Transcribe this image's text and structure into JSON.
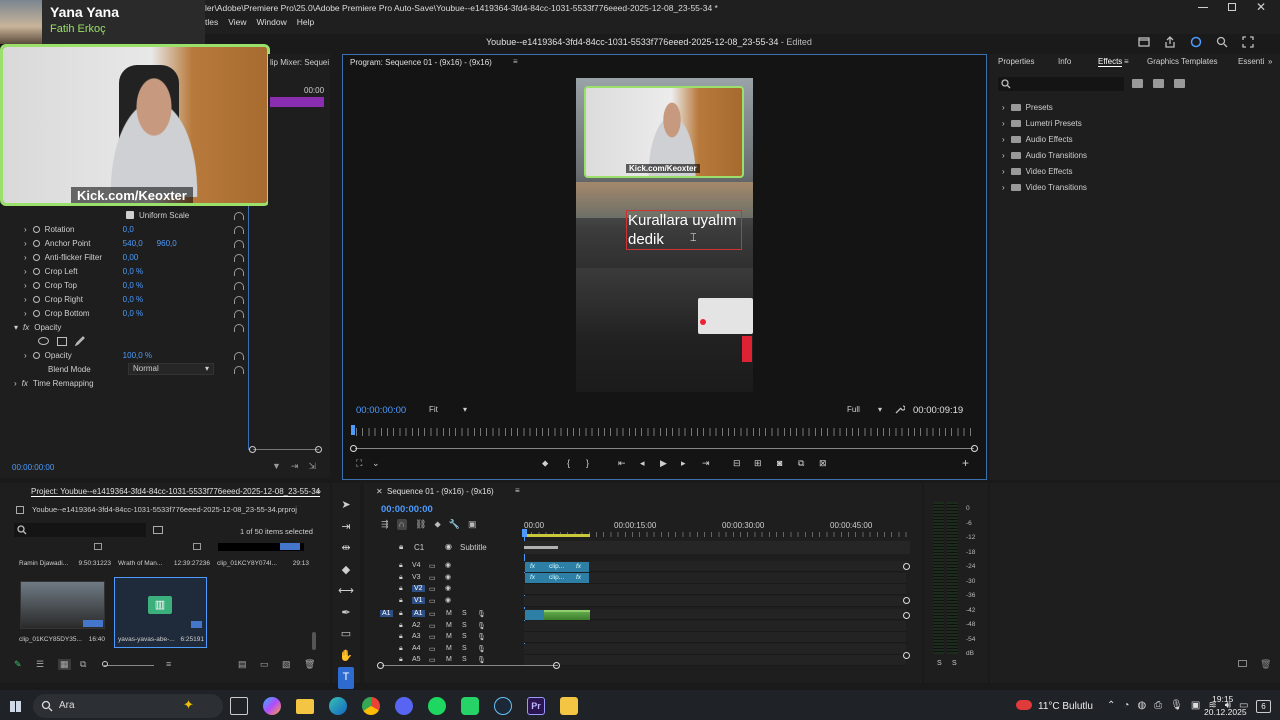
{
  "streamer": {
    "title": "Yana Yana",
    "subtitle": "Fatih Erkoç",
    "watermark": "Kick.com/Keoxter"
  },
  "titlebar": {
    "path": "ler\\Adobe\\Premiere Pro\\25.0\\Adobe Premiere Pro Auto-Save\\Youbue--e1419364-3fd4-84cc-1031-5533f776eeed-2025-12-08_23-55-34 *"
  },
  "menu": {
    "items": [
      "tles",
      "View",
      "Window",
      "Help"
    ]
  },
  "header": {
    "doc_title": "Youbue--e1419364-3fd4-84cc-1031-5533f776eeed-2025-12-08_23-55-34",
    "edited": " - Edited"
  },
  "mixer": {
    "tab": "lip Mixer: Sequei",
    "time": "00:00"
  },
  "effect_controls": {
    "uniform_scale": "Uniform Scale",
    "rows": [
      {
        "label": "Rotation",
        "v1": "0,0",
        "v2": ""
      },
      {
        "label": "Anchor Point",
        "v1": "540,0",
        "v2": "960,0"
      },
      {
        "label": "Anti-flicker Filter",
        "v1": "0,00",
        "v2": ""
      },
      {
        "label": "Crop Left",
        "v1": "0,0 %",
        "v2": ""
      },
      {
        "label": "Crop Top",
        "v1": "0,0 %",
        "v2": ""
      },
      {
        "label": "Crop Right",
        "v1": "0,0 %",
        "v2": ""
      },
      {
        "label": "Crop Bottom",
        "v1": "0,0 %",
        "v2": ""
      }
    ],
    "opacity_section": "Opacity",
    "opacity_label": "Opacity",
    "opacity_value": "100,0 %",
    "blend_label": "Blend Mode",
    "blend_value": "Normal",
    "time_remap": "Time Remapping",
    "timecode": "00:00:00:00"
  },
  "program": {
    "tab": "Program: Sequence 01 - (9x16) - (9x16)",
    "caption_line1": "Kurallara uyalım",
    "caption_line2": "dedik",
    "overlay_watermark": "Kick.com/Keoxter",
    "timecode": "00:00:00:00",
    "fit": "Fit",
    "quality": "Full",
    "duration": "00:00:09:19"
  },
  "right_panel": {
    "tabs": [
      "Properties",
      "Info",
      "Effects",
      "Graphics Templates",
      "Essenti"
    ],
    "tree": [
      "Presets",
      "Lumetri Presets",
      "Audio Effects",
      "Audio Transitions",
      "Video Effects",
      "Video Transitions"
    ]
  },
  "project": {
    "tab": "Project: Youbue--e1419364-3fd4-84cc-1031-5533f776eeed-2025-12-08_23-55-34",
    "file": "Youbue--e1419364-3fd4-84cc-1031-5533f776eeed-2025-12-08_23-55-34.prproj",
    "count": "1 of 50 items selected",
    "items_row1": [
      {
        "name": "Ramin Djawadi...",
        "dur": "9:50:31223"
      },
      {
        "name": "Wrath of Man...",
        "dur": "12:39:27236"
      },
      {
        "name": "clip_01KCY8Y074I...",
        "dur": "29:13"
      }
    ],
    "items_row2": [
      {
        "name": "clip_01KCY85DY35...",
        "dur": "16:40"
      },
      {
        "name": "yavas-yavas-abe-...",
        "dur": "6:25191"
      }
    ]
  },
  "timeline": {
    "tab": "Sequence 01 - (9x16) - (9x16)",
    "timecode": "00:00:00:00",
    "ruler": [
      "00:00",
      "00:00:15:00",
      "00:00:30:00",
      "00:00:45:00"
    ],
    "subtitle_track": "Subtitle",
    "c1": "C1",
    "video_tracks": [
      "V4",
      "V3",
      "V2",
      "V1"
    ],
    "audio_tracks": [
      "A1",
      "A2",
      "A3",
      "A4",
      "A5"
    ],
    "clip_label": "clip..."
  },
  "meter": {
    "labels": [
      "0",
      "-6",
      "-12",
      "-18",
      "-24",
      "-30",
      "-36",
      "-42",
      "-48",
      "-54",
      "dB"
    ],
    "s_left": "S",
    "s_right": "S"
  },
  "taskbar": {
    "search": "Ara",
    "weather": "11°C  Bulutlu",
    "time": "19:15",
    "date": "20.12.2025",
    "notif": "6"
  }
}
